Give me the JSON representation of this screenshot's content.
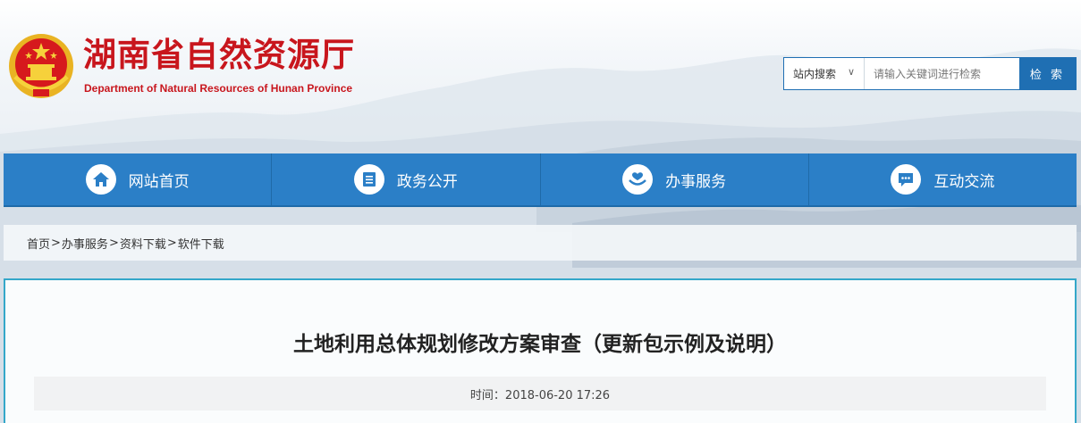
{
  "header": {
    "title": "湖南省自然资源厅",
    "subtitle": "Department of Natural Resources of Hunan Province"
  },
  "search": {
    "scope_label": "站内搜索",
    "placeholder": "请输入关键词进行检索",
    "button_label": "检 索"
  },
  "nav": {
    "items": [
      {
        "label": "网站首页",
        "icon": "home-icon"
      },
      {
        "label": "政务公开",
        "icon": "document-list-icon"
      },
      {
        "label": "办事服务",
        "icon": "hand-heart-icon"
      },
      {
        "label": "互动交流",
        "icon": "chat-bubble-icon"
      }
    ]
  },
  "breadcrumb": {
    "items": [
      "首页",
      "办事服务",
      "资料下载",
      "软件下载"
    ],
    "separator": ">"
  },
  "article": {
    "title": "土地利用总体规划修改方案审查（更新包示例及说明）",
    "time": "时间：2018-06-20 17:26"
  },
  "colors": {
    "brand_red": "#c8161d",
    "nav_blue": "#2b7fc7",
    "content_border": "#34a7c9"
  }
}
